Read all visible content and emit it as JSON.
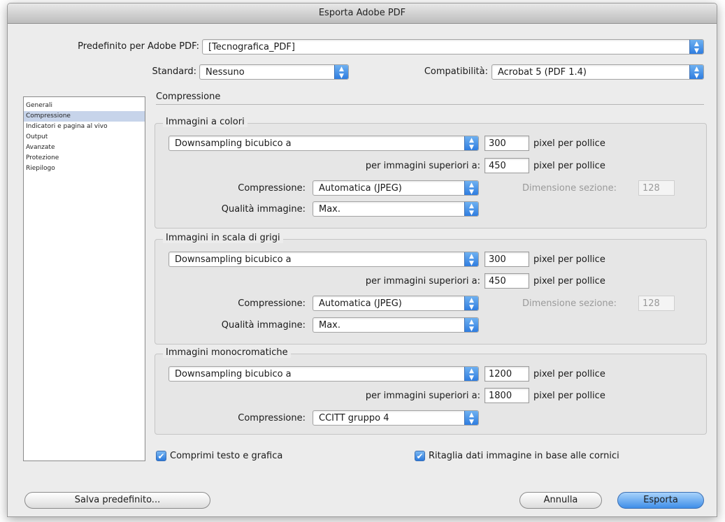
{
  "window": {
    "title": "Esporta Adobe PDF"
  },
  "preset": {
    "label": "Predefinito per Adobe PDF:",
    "value": "[Tecnografica_PDF]"
  },
  "standard": {
    "label": "Standard:",
    "value": "Nessuno"
  },
  "compat": {
    "label": "Compatibilità:",
    "value": "Acrobat 5 (PDF 1.4)"
  },
  "sidebar": {
    "items": [
      {
        "label": "Generali"
      },
      {
        "label": "Compressione"
      },
      {
        "label": "Indicatori e pagina al vivo"
      },
      {
        "label": "Output"
      },
      {
        "label": "Avanzate"
      },
      {
        "label": "Protezione"
      },
      {
        "label": "Riepilogo"
      }
    ]
  },
  "section": {
    "title": "Compressione"
  },
  "color": {
    "title": "Immagini a colori",
    "downsampling": "Downsampling bicubico a",
    "ppi": "300",
    "ppi_unit": "pixel per pollice",
    "above_label": "per immagini superiori a:",
    "above": "450",
    "above_unit": "pixel per pollice",
    "compression_label": "Compressione:",
    "compression": "Automatica (JPEG)",
    "tile_label": "Dimensione sezione:",
    "tile": "128",
    "quality_label": "Qualità immagine:",
    "quality": "Max."
  },
  "gray": {
    "title": "Immagini in scala di grigi",
    "downsampling": "Downsampling bicubico a",
    "ppi": "300",
    "ppi_unit": "pixel per pollice",
    "above_label": "per immagini superiori a:",
    "above": "450",
    "above_unit": "pixel per pollice",
    "compression_label": "Compressione:",
    "compression": "Automatica (JPEG)",
    "tile_label": "Dimensione sezione:",
    "tile": "128",
    "quality_label": "Qualità immagine:",
    "quality": "Max."
  },
  "mono": {
    "title": "Immagini monocromatiche",
    "downsampling": "Downsampling bicubico a",
    "ppi": "1200",
    "ppi_unit": "pixel per pollice",
    "above_label": "per immagini superiori a:",
    "above": "1800",
    "above_unit": "pixel per pollice",
    "compression_label": "Compressione:",
    "compression": "CCITT gruppo 4"
  },
  "options": {
    "compress_text": "Comprimi testo e grafica",
    "crop_images": "Ritaglia dati immagine in base alle cornici"
  },
  "buttons": {
    "save_preset": "Salva predefinito...",
    "cancel": "Annulla",
    "export": "Esporta"
  },
  "colors": {
    "accent": "#3f8ee8",
    "selection": "#c7d4ea"
  }
}
